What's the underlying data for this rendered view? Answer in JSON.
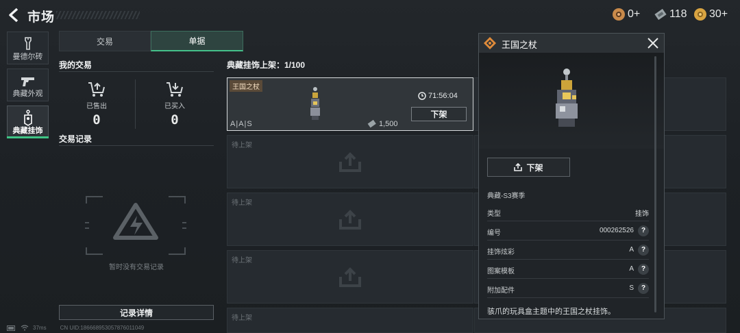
{
  "header": {
    "title": "市场",
    "currencies": [
      {
        "icon": "coin-token-icon",
        "value": "0+",
        "color": "#c98a4a"
      },
      {
        "icon": "banknote-icon",
        "value": "118",
        "color": "#9aa3a7"
      },
      {
        "icon": "gold-coin-icon",
        "value": "30+",
        "color": "#d9a441"
      }
    ]
  },
  "nav": [
    {
      "label": "曼德尔砖",
      "icon": "brick-icon",
      "active": false
    },
    {
      "label": "典藏外观",
      "icon": "gun-icon",
      "active": false
    },
    {
      "label": "典藏挂饰",
      "icon": "charm-tag-icon",
      "active": true
    }
  ],
  "tabs": [
    {
      "label": "交易",
      "active": false
    },
    {
      "label": "单据",
      "active": true
    }
  ],
  "my_trades": {
    "title": "我的交易",
    "sold_label": "已售出",
    "sold_value": "0",
    "bought_label": "已买入",
    "bought_value": "0"
  },
  "history": {
    "title": "交易记录",
    "empty_text": "暂时没有交易记录",
    "details_button": "记录详情"
  },
  "listings": {
    "header": "典藏挂饰上架：1/100",
    "active": {
      "name": "王国之杖",
      "grades": "A|A|S",
      "price": "1,500",
      "timer": "71:56:04",
      "delist_button": "下架"
    },
    "pending_label": "待上架",
    "pending_count": 4
  },
  "detail": {
    "title": "王国之杖",
    "delist_button": "下架",
    "season": "典藏-S3赛季",
    "rows": [
      {
        "key": "类型",
        "value": "挂饰",
        "help": false
      },
      {
        "key": "编号",
        "value": "000262526",
        "help": true
      },
      {
        "key": "挂饰炫彩",
        "value": "A",
        "help": true
      },
      {
        "key": "图案模板",
        "value": "A",
        "help": true
      },
      {
        "key": "附加配件",
        "value": "S",
        "help": true
      }
    ],
    "description": "骇爪的玩具盒主题中的王国之杖挂饰。",
    "help_glyph": "?"
  },
  "footer": {
    "ping": "37ms",
    "uid": "CN UID:18666895305787601104​9"
  },
  "colors": {
    "accent": "#45c08a",
    "tag_bg": "#5a4a38"
  }
}
